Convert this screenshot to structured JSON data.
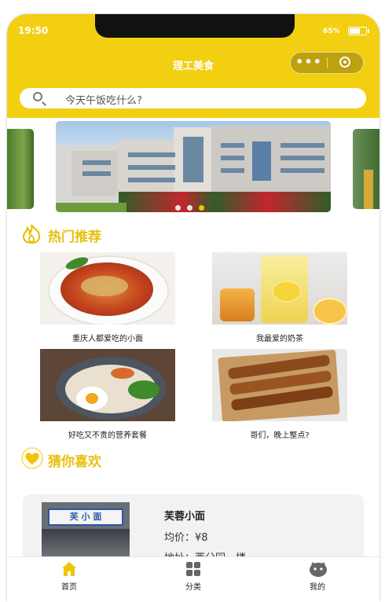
{
  "status_bar": {
    "time": "19:50",
    "battery": "65%"
  },
  "nav": {
    "title": "理工美食"
  },
  "search": {
    "placeholder": "今天午饭吃什么?"
  },
  "sections": {
    "hot": "热门推荐",
    "guess": "猜你喜欢"
  },
  "hot_items": [
    {
      "caption": "重庆人都爱吃的小面"
    },
    {
      "caption": "我最爱的奶茶"
    },
    {
      "caption": "好吃又不贵的营养套餐"
    },
    {
      "caption": "哥们，晚上整点?"
    }
  ],
  "recommend": {
    "name": "芙蓉小面",
    "price": "均价：¥8",
    "address": "地址：西分园一楼",
    "sign_text": "芙 小 面"
  },
  "tabbar": [
    {
      "label": "首页",
      "icon": "home-icon",
      "active": true
    },
    {
      "label": "分类",
      "icon": "category-icon",
      "active": false
    },
    {
      "label": "我的",
      "icon": "profile-icon",
      "active": false
    }
  ],
  "colors": {
    "accent": "#f3cf11",
    "heading": "#e8c00e",
    "active_dot": "#f0c400"
  }
}
